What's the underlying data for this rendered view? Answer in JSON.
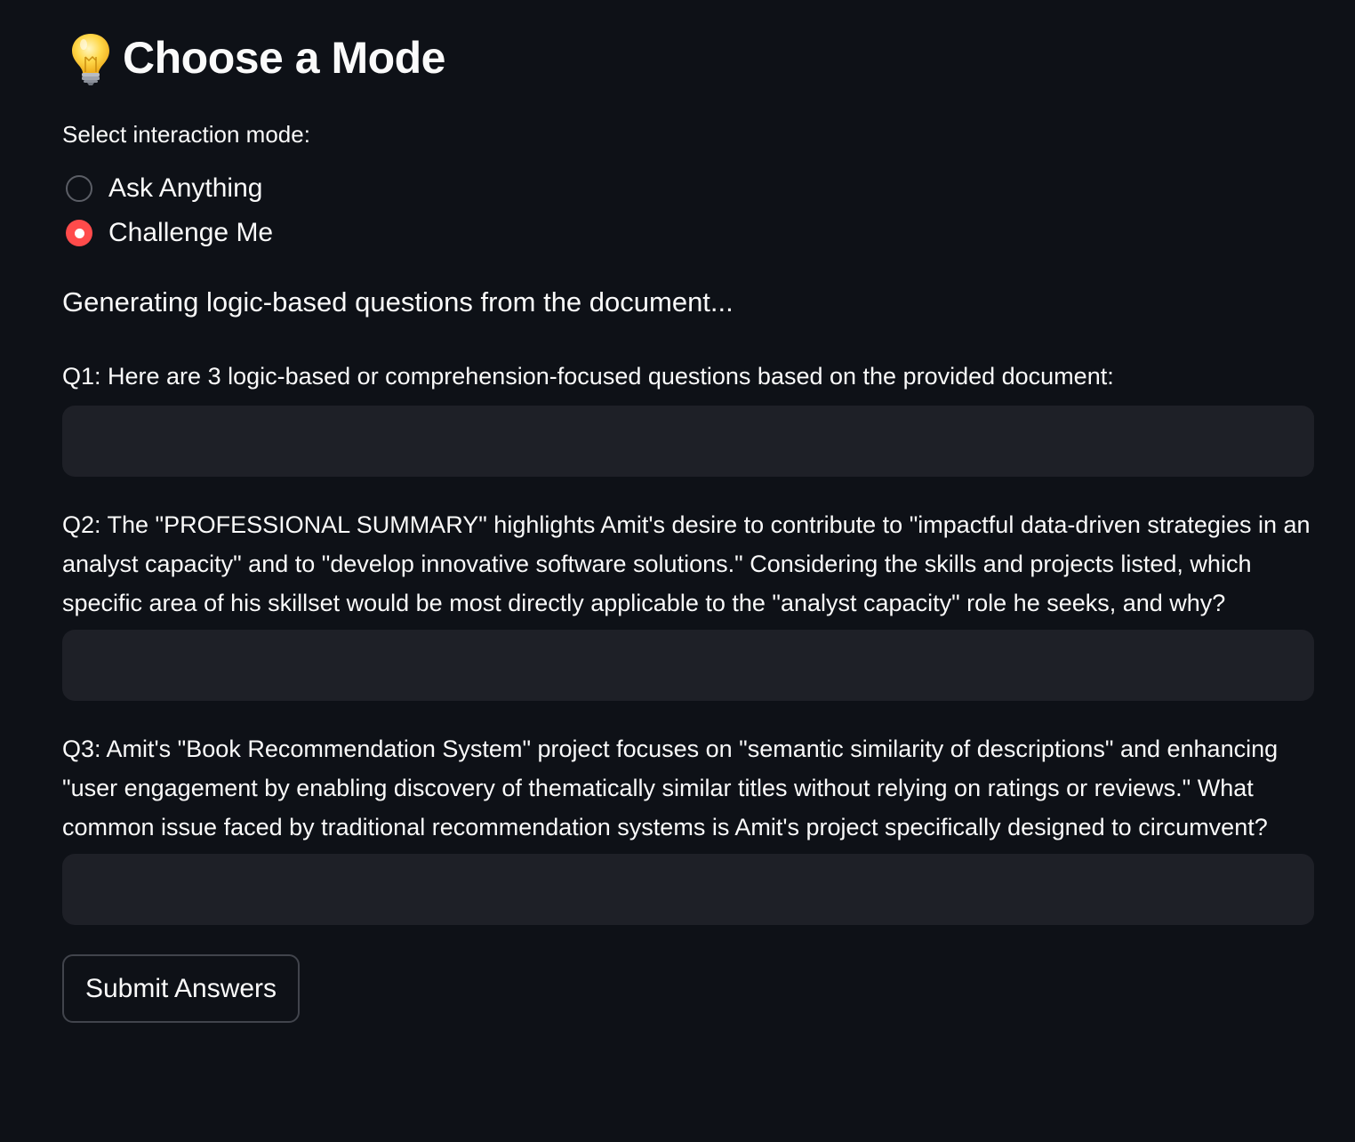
{
  "header": {
    "icon": "lightbulb-icon",
    "title": "Choose a Mode"
  },
  "mode_selector": {
    "label": "Select interaction mode:",
    "options": [
      {
        "label": "Ask Anything",
        "selected": false
      },
      {
        "label": "Challenge Me",
        "selected": true
      }
    ]
  },
  "status_text": "Generating logic-based questions from the document...",
  "questions": [
    {
      "label": "Q1: Here are 3 logic-based or comprehension-focused questions based on the provided document:",
      "answer": ""
    },
    {
      "label": "Q2: The \"PROFESSIONAL SUMMARY\" highlights Amit's desire to contribute to \"impactful data-driven strategies in an analyst capacity\" and to \"develop innovative software solutions.\" Considering the skills and projects listed, which specific area of his skillset would be most directly applicable to the \"analyst capacity\" role he seeks, and why?",
      "answer": ""
    },
    {
      "label": "Q3: Amit's \"Book Recommendation System\" project focuses on \"semantic similarity of descriptions\" and enhancing \"user engagement by enabling discovery of thematically similar titles without relying on ratings or reviews.\" What common issue faced by traditional recommendation systems is Amit's project specifically designed to circumvent?",
      "answer": ""
    }
  ],
  "submit_button": {
    "label": "Submit Answers"
  },
  "colors": {
    "background": "#0e1117",
    "text": "#fafafa",
    "input_background": "#1e2027",
    "accent": "#ff4b4b",
    "border": "#41444c"
  }
}
